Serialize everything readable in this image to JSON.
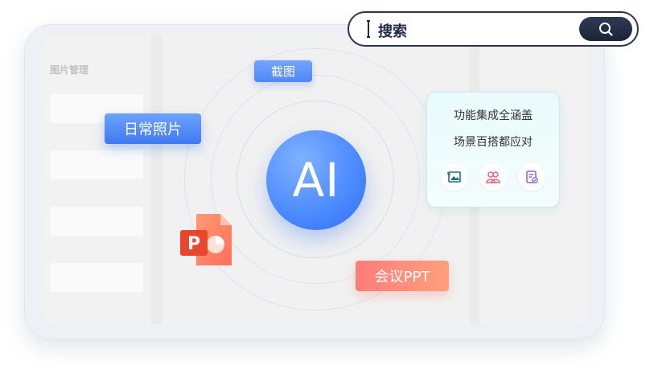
{
  "search": {
    "text": "搜索",
    "button_icon": "search-icon"
  },
  "sidebar": {
    "title": "图片管理"
  },
  "center": {
    "ai_label": "AI"
  },
  "tags": {
    "screenshot": "截图",
    "daily_photos": "日常照片",
    "meeting_ppt": "会议PPT"
  },
  "feature_card": {
    "line1": "功能集成全涵盖",
    "line2": "场景百搭都应对",
    "icons": [
      "image-icon",
      "people-icon",
      "document-check-icon"
    ]
  },
  "colors": {
    "ai_blue": "#4e8cff",
    "tag_blue": "#5a8ff8",
    "tag_coral": "#ff8a7c",
    "search_dark": "#1f2a44",
    "card_teal": "#c9ecee"
  }
}
